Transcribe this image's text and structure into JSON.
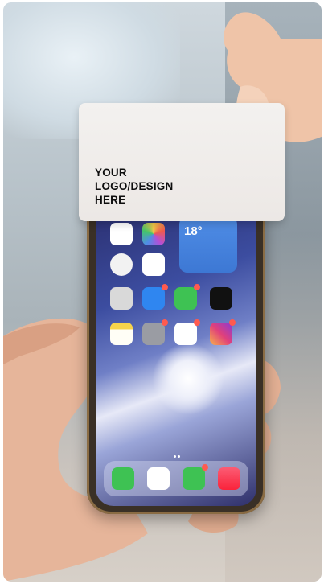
{
  "card": {
    "line1": "YOUR",
    "line2": "LOGO/DESIGN",
    "line3": "HERE"
  },
  "widget": {
    "temperature": "18°"
  },
  "colors": {
    "card": "#efece9",
    "phone_frame": "#8a6c44",
    "skin": "#e8b89a"
  },
  "icons": [
    "phone-app-icon",
    "safari-icon",
    "messages-icon",
    "music-icon",
    "camera-icon",
    "mail-icon",
    "whatsapp-icon",
    "tiktok-icon",
    "notes-icon",
    "settings-icon",
    "youtube-icon",
    "instagram-icon"
  ]
}
